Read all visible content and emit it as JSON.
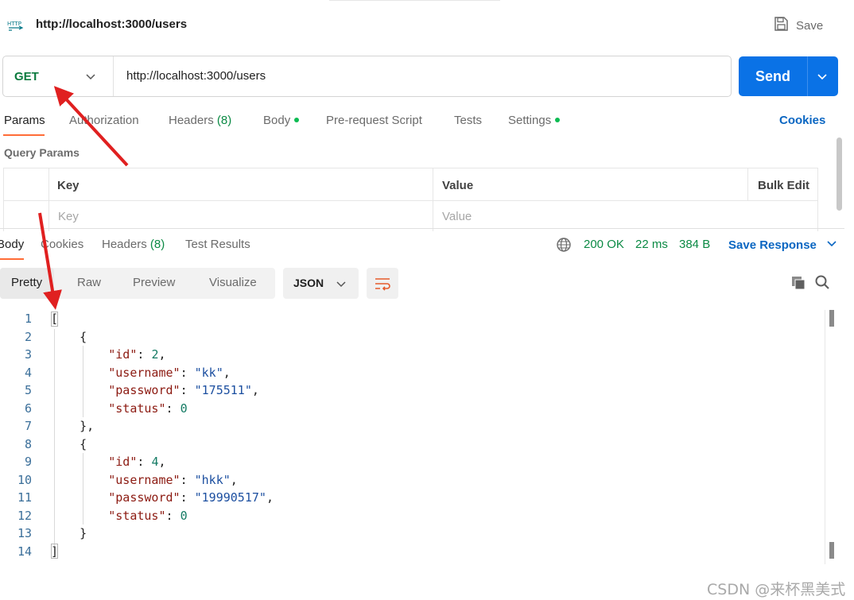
{
  "request": {
    "name": "http://localhost:3000/users",
    "save_label": "Save",
    "method": "GET",
    "url": "http://localhost:3000/users",
    "send_label": "Send"
  },
  "request_tabs": [
    {
      "label": "Params",
      "badge": "",
      "dot": false
    },
    {
      "label": "Authorization",
      "badge": "",
      "dot": false
    },
    {
      "label": "Headers",
      "badge": "(8)",
      "dot": false
    },
    {
      "label": "Body",
      "badge": "",
      "dot": true
    },
    {
      "label": "Pre-request Script",
      "badge": "",
      "dot": false
    },
    {
      "label": "Tests",
      "badge": "",
      "dot": false
    },
    {
      "label": "Settings",
      "badge": "",
      "dot": true
    }
  ],
  "cookies_label": "Cookies",
  "query_params": {
    "title": "Query Params",
    "col_key": "Key",
    "col_value": "Value",
    "bulk_edit": "Bulk Edit",
    "key_placeholder": "Key",
    "value_placeholder": "Value"
  },
  "response_tabs": {
    "body": "Body",
    "cookies": "Cookies",
    "headers": "Headers",
    "headers_badge": "(8)",
    "test_results": "Test Results"
  },
  "status": {
    "code": "200 OK",
    "time": "22 ms",
    "size": "384 B",
    "save_response": "Save Response"
  },
  "view_modes": [
    "Pretty",
    "Raw",
    "Preview",
    "Visualize"
  ],
  "format": "JSON",
  "code_lines": [
    "1",
    "2",
    "3",
    "4",
    "5",
    "6",
    "7",
    "8",
    "9",
    "10",
    "11",
    "12",
    "13",
    "14"
  ],
  "response_body": [
    {
      "id": "2",
      "username": "\"kk\"",
      "password": "\"175511\"",
      "status": "0"
    },
    {
      "id": "4",
      "username": "\"hkk\"",
      "password": "\"19990517\"",
      "status": "0"
    }
  ],
  "json_keys": {
    "id": "\"id\"",
    "username": "\"username\"",
    "password": "\"password\"",
    "status": "\"status\""
  },
  "watermark": "CSDN @来杯黑美式",
  "colors": {
    "accent": "#ff6c37",
    "send": "#0a72e6",
    "link": "#0a66c2",
    "success": "#0b8a44",
    "annotation_arrow": "#e02020"
  },
  "icons": [
    "http-icon",
    "save-icon",
    "chevron-down-icon",
    "globe-icon",
    "copy-icon",
    "search-icon",
    "wrap-lines-icon"
  ]
}
